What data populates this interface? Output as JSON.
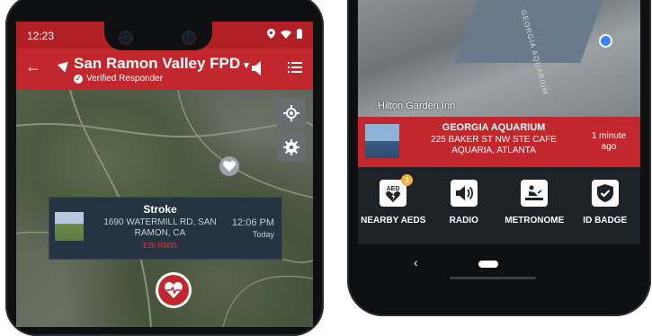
{
  "left_phone": {
    "status": {
      "time": "12:23"
    },
    "toolbar": {
      "title": "San Ramon Valley FPD",
      "subtitle": "Verified Responder"
    },
    "incident": {
      "type": "Stroke",
      "address": "1690 WATERMILL RD, SAN RAMON, CA",
      "units": "E30 RM35",
      "time": "12:06 PM",
      "day": "Today"
    }
  },
  "right_phone": {
    "map_label": "Hilton Garden Inn",
    "map_building": "GEORGIA AQUARIUM",
    "location": {
      "name": "GEORGIA AQUARIUM",
      "address_line1": "225 BAKER ST NW STE CAFE",
      "address_line2": "AQUARIA, ATLANTA",
      "time_ago": "1 minute ago"
    },
    "actions": [
      {
        "label": "NEARBY AEDS",
        "icon": "aed-icon",
        "badge": "1"
      },
      {
        "label": "RADIO",
        "icon": "radio-speaker-icon"
      },
      {
        "label": "METRONOME",
        "icon": "metronome-cpr-icon"
      },
      {
        "label": "ID BADGE",
        "icon": "id-badge-shield-icon"
      }
    ]
  },
  "colors": {
    "brand_red": "#c1272d",
    "status_red": "#b21f24",
    "card_bg": "#263442",
    "accent_orange": "#f2b33d"
  }
}
